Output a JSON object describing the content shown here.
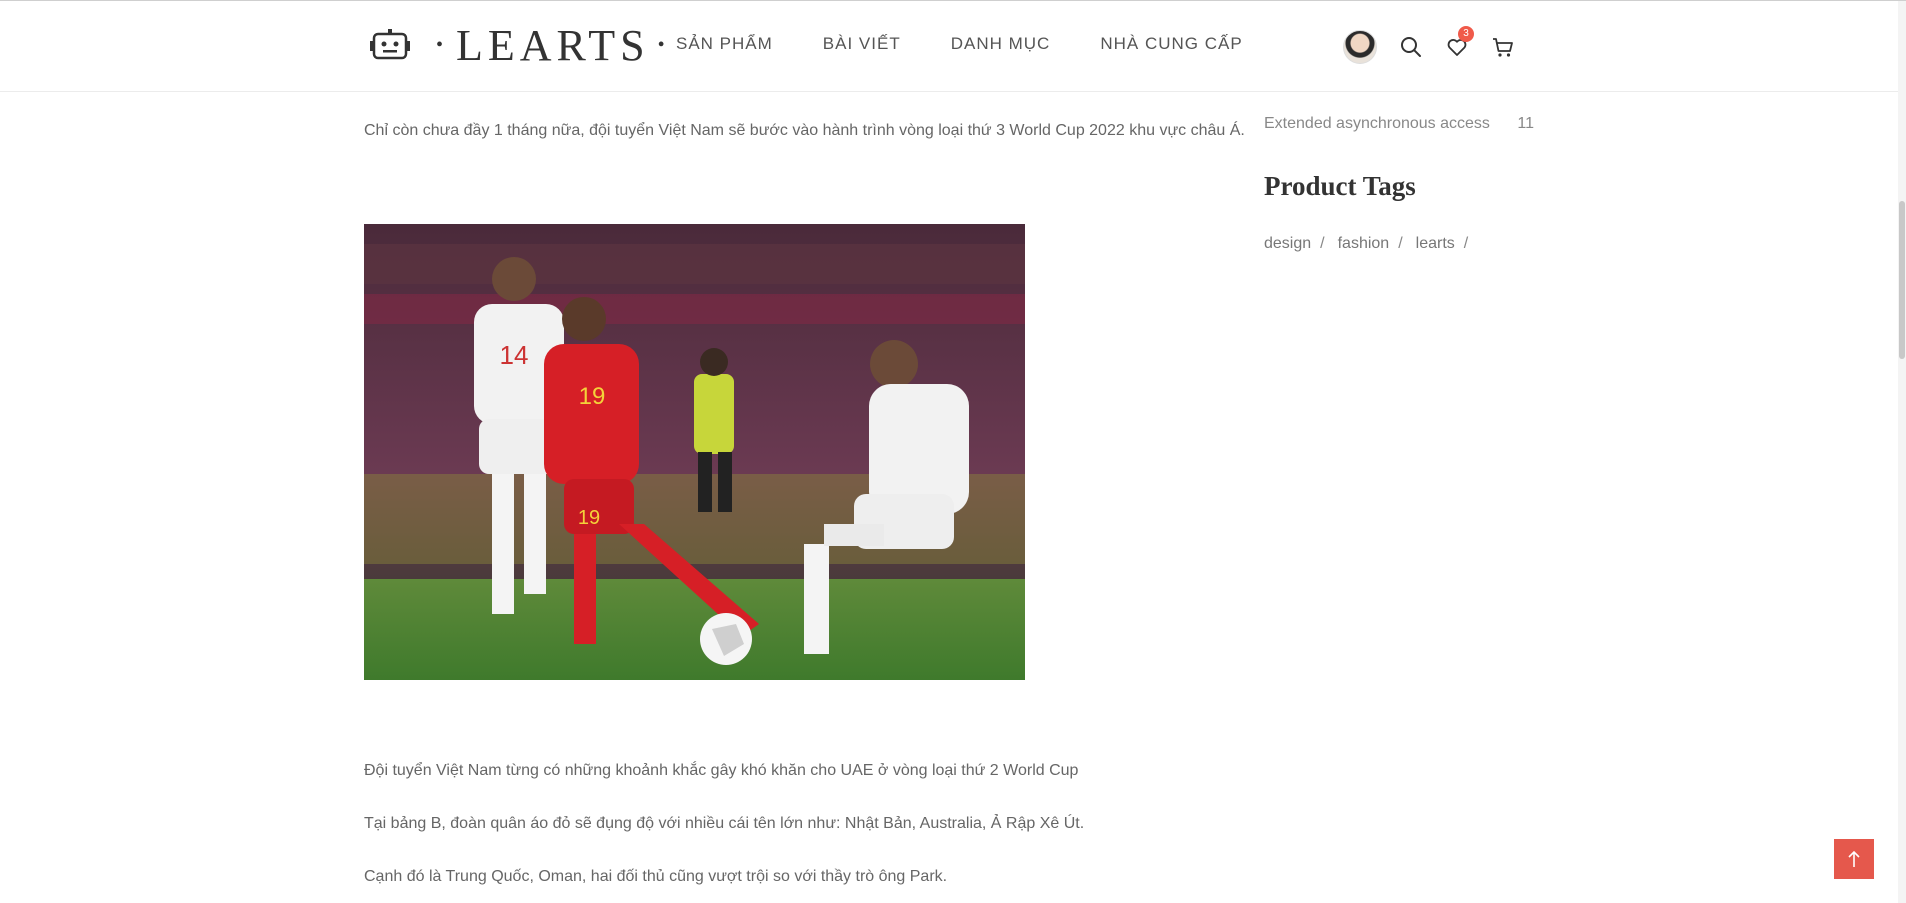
{
  "brand": {
    "name": "LEARTS"
  },
  "nav": {
    "items": [
      {
        "label": "SẢN PHẨM"
      },
      {
        "label": "BÀI VIẾT"
      },
      {
        "label": "DANH MỤC"
      },
      {
        "label": "NHÀ CUNG CẤP"
      }
    ]
  },
  "header": {
    "icons": [
      "avatar",
      "search-icon",
      "heart-icon",
      "cart-icon"
    ],
    "wishlist_count": "3"
  },
  "article": {
    "intro": "Chỉ còn chưa đầy 1 tháng nữa, đội tuyển Việt Nam sẽ bước vào hành trình vòng loại thứ 3 World Cup 2022 khu vực châu Á.",
    "paragraphs": [
      "Đội tuyển Việt Nam từng có những khoảnh khắc gây khó khăn cho UAE ở vòng loại thứ 2 World Cup",
      "Tại bảng B, đoàn quân áo đỏ sẽ đụng độ với nhiều cái tên lớn như: Nhật Bản, Australia, Ả Rập Xê Út.",
      "Cạnh đó là Trung Quốc, Oman, hai đối thủ cũng vượt trội so với thầy trò ông Park."
    ]
  },
  "sidebar": {
    "category": {
      "label": "Extended asynchronous access",
      "count": "11"
    },
    "tags_title": "Product Tags",
    "tags": [
      "design",
      "fashion",
      "learts"
    ],
    "tag_separator": "/"
  },
  "colors": {
    "accent": "#e5584c",
    "badge": "#f05a4a",
    "text": "#666666"
  }
}
